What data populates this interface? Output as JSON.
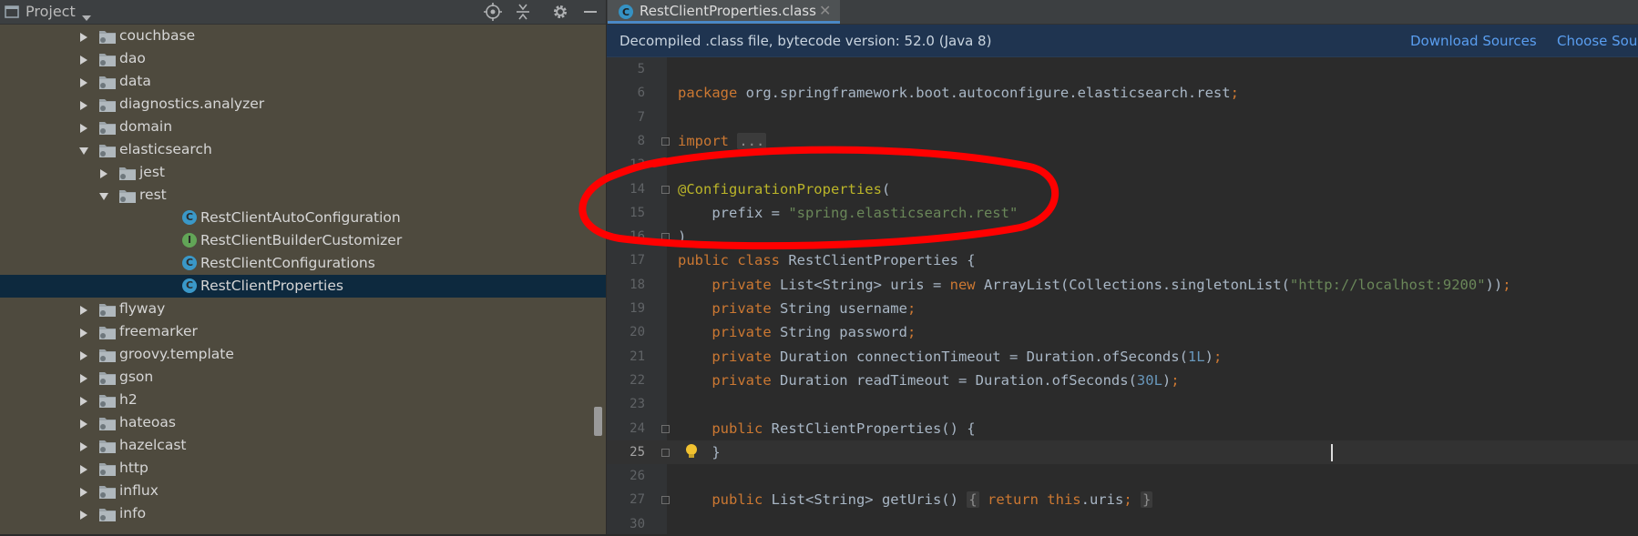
{
  "project_panel": {
    "title": "Project",
    "tree": [
      {
        "label": "couchbase",
        "kind": "folder",
        "expanded": false,
        "indent": 1
      },
      {
        "label": "dao",
        "kind": "folder",
        "expanded": false,
        "indent": 1
      },
      {
        "label": "data",
        "kind": "folder",
        "expanded": false,
        "indent": 1
      },
      {
        "label": "diagnostics.analyzer",
        "kind": "folder",
        "expanded": false,
        "indent": 1
      },
      {
        "label": "domain",
        "kind": "folder",
        "expanded": false,
        "indent": 1
      },
      {
        "label": "elasticsearch",
        "kind": "folder",
        "expanded": true,
        "indent": 1
      },
      {
        "label": "jest",
        "kind": "folder",
        "expanded": false,
        "indent": 2
      },
      {
        "label": "rest",
        "kind": "folder",
        "expanded": true,
        "indent": 2
      },
      {
        "label": "RestClientAutoConfiguration",
        "kind": "class",
        "indent": 3
      },
      {
        "label": "RestClientBuilderCustomizer",
        "kind": "interface",
        "indent": 3
      },
      {
        "label": "RestClientConfigurations",
        "kind": "class",
        "indent": 3
      },
      {
        "label": "RestClientProperties",
        "kind": "class",
        "indent": 3,
        "selected": true
      },
      {
        "label": "flyway",
        "kind": "folder",
        "expanded": false,
        "indent": 1
      },
      {
        "label": "freemarker",
        "kind": "folder",
        "expanded": false,
        "indent": 1
      },
      {
        "label": "groovy.template",
        "kind": "folder",
        "expanded": false,
        "indent": 1
      },
      {
        "label": "gson",
        "kind": "folder",
        "expanded": false,
        "indent": 1
      },
      {
        "label": "h2",
        "kind": "folder",
        "expanded": false,
        "indent": 1
      },
      {
        "label": "hateoas",
        "kind": "folder",
        "expanded": false,
        "indent": 1
      },
      {
        "label": "hazelcast",
        "kind": "folder",
        "expanded": false,
        "indent": 1
      },
      {
        "label": "http",
        "kind": "folder",
        "expanded": false,
        "indent": 1
      },
      {
        "label": "influx",
        "kind": "folder",
        "expanded": false,
        "indent": 1
      },
      {
        "label": "info",
        "kind": "folder",
        "expanded": false,
        "indent": 1
      }
    ]
  },
  "editor": {
    "tab": {
      "label": "RestClientProperties.class",
      "close": "✕"
    },
    "banner": {
      "message": "Decompiled .class file, bytecode version: 52.0 (Java 8)",
      "download_sources": "Download Sources",
      "choose_sources": "Choose Sou"
    },
    "lines": [
      {
        "num": "5",
        "tokens": []
      },
      {
        "num": "6",
        "tokens": [
          [
            "kw",
            "package "
          ],
          [
            "p",
            "org.springframework.boot.autoconfigure.elasticsearch.rest"
          ],
          [
            "kw",
            ";"
          ]
        ]
      },
      {
        "num": "7",
        "tokens": []
      },
      {
        "num": "8",
        "fold": true,
        "tokens": [
          [
            "kw",
            "import "
          ],
          [
            "fold",
            "..."
          ]
        ]
      },
      {
        "num": "13",
        "tokens": []
      },
      {
        "num": "14",
        "fold": true,
        "tokens": [
          [
            "ann",
            "@ConfigurationProperties"
          ],
          [
            "p",
            "("
          ]
        ]
      },
      {
        "num": "15",
        "tokens": [
          [
            "p",
            "    prefix = "
          ],
          [
            "str",
            "\"spring.elasticsearch.rest\""
          ]
        ]
      },
      {
        "num": "16",
        "fold": true,
        "tokens": [
          [
            "p",
            ")"
          ]
        ]
      },
      {
        "num": "17",
        "tokens": [
          [
            "kw",
            "public class "
          ],
          [
            "p",
            "RestClientProperties {"
          ]
        ]
      },
      {
        "num": "18",
        "tokens": [
          [
            "kw",
            "    private "
          ],
          [
            "p",
            "List<String> uris = "
          ],
          [
            "kw",
            "new "
          ],
          [
            "p",
            "ArrayList(Collections.singletonList("
          ],
          [
            "str",
            "\"http://localhost:9200\""
          ],
          [
            "p",
            "))"
          ],
          [
            "kw",
            ";"
          ]
        ]
      },
      {
        "num": "19",
        "tokens": [
          [
            "kw",
            "    private "
          ],
          [
            "p",
            "String username"
          ],
          [
            "kw",
            ";"
          ]
        ]
      },
      {
        "num": "20",
        "tokens": [
          [
            "kw",
            "    private "
          ],
          [
            "p",
            "String password"
          ],
          [
            "kw",
            ";"
          ]
        ]
      },
      {
        "num": "21",
        "tokens": [
          [
            "kw",
            "    private "
          ],
          [
            "p",
            "Duration connectionTimeout = Duration.ofSeconds("
          ],
          [
            "num",
            "1L"
          ],
          [
            "p",
            ")"
          ],
          [
            "kw",
            ";"
          ]
        ]
      },
      {
        "num": "22",
        "tokens": [
          [
            "kw",
            "    private "
          ],
          [
            "p",
            "Duration readTimeout = Duration.ofSeconds("
          ],
          [
            "num",
            "30L"
          ],
          [
            "p",
            ")"
          ],
          [
            "kw",
            ";"
          ]
        ]
      },
      {
        "num": "23",
        "tokens": []
      },
      {
        "num": "24",
        "fold": true,
        "tokens": [
          [
            "kw",
            "    public "
          ],
          [
            "p",
            "RestClientProperties() {"
          ]
        ]
      },
      {
        "num": "25",
        "fold": true,
        "current": true,
        "bulb": true,
        "tokens": [
          [
            "p",
            "    }"
          ]
        ]
      },
      {
        "num": "26",
        "tokens": []
      },
      {
        "num": "27",
        "fold": true,
        "tokens": [
          [
            "kw",
            "    public "
          ],
          [
            "p",
            "List<String> getUris() "
          ],
          [
            "fold",
            "{"
          ],
          [
            "p",
            " "
          ],
          [
            "kw",
            "return this"
          ],
          [
            "p",
            ".uris"
          ],
          [
            "kw",
            ";"
          ],
          [
            "p",
            " "
          ],
          [
            "fold",
            "}"
          ]
        ]
      },
      {
        "num": "30",
        "tokens": []
      }
    ]
  },
  "colors": {
    "keyword": "#cc7832",
    "string": "#6a8759",
    "number": "#6897bb",
    "annotation": "#bbb529",
    "plain": "#a9b7c6",
    "selection": "#0d293e",
    "highlight_circle": "#ff0000"
  }
}
